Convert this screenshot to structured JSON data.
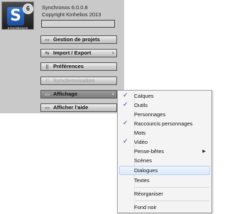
{
  "app": {
    "version": "Synchronos 6.0.0.8",
    "copyright": "Copyright Kinhelios 2013",
    "logo_badge": "6",
    "logo_letter": "S",
    "logo_word": "SYNCHRONOS"
  },
  "menu_buttons": [
    {
      "label": "Gestion de projets",
      "icon": "folder-icon",
      "state": "normal"
    },
    {
      "label": "Import / Export",
      "icon": "import-export-icon",
      "state": "normal"
    },
    {
      "label": "Préférences",
      "icon": "preferences-icon",
      "state": "normal"
    },
    {
      "label": "Synchronisation",
      "icon": "sync-icon",
      "state": "disabled"
    },
    {
      "label": "Affichage",
      "icon": "display-icon",
      "state": "active"
    },
    {
      "label": "Afficher l'aide",
      "icon": "help-icon",
      "state": "normal"
    }
  ],
  "context_menu": {
    "items": [
      {
        "label": "Calques",
        "checked": true
      },
      {
        "label": "Outils",
        "checked": true
      },
      {
        "label": "Personnages",
        "checked": false
      },
      {
        "label": "Raccourcis personnages",
        "checked": true
      },
      {
        "label": "Mots",
        "checked": false
      },
      {
        "label": "Vidéo",
        "checked": true
      },
      {
        "label": "Pense-bêtes",
        "checked": false,
        "submenu": true
      },
      {
        "label": "Scènes",
        "checked": false
      },
      {
        "label": "Dialogues",
        "checked": false,
        "highlighted": true
      },
      {
        "label": "Textes",
        "checked": false
      },
      {
        "label": "Réorganiser",
        "checked": false
      },
      {
        "label": "Fond noir",
        "checked": false
      }
    ],
    "check_glyph": "✓",
    "submenu_glyph": "▶"
  },
  "colors": {
    "panel": "#c9c9c9",
    "check": "#1a3e8c",
    "highlight": "#dceafb"
  }
}
